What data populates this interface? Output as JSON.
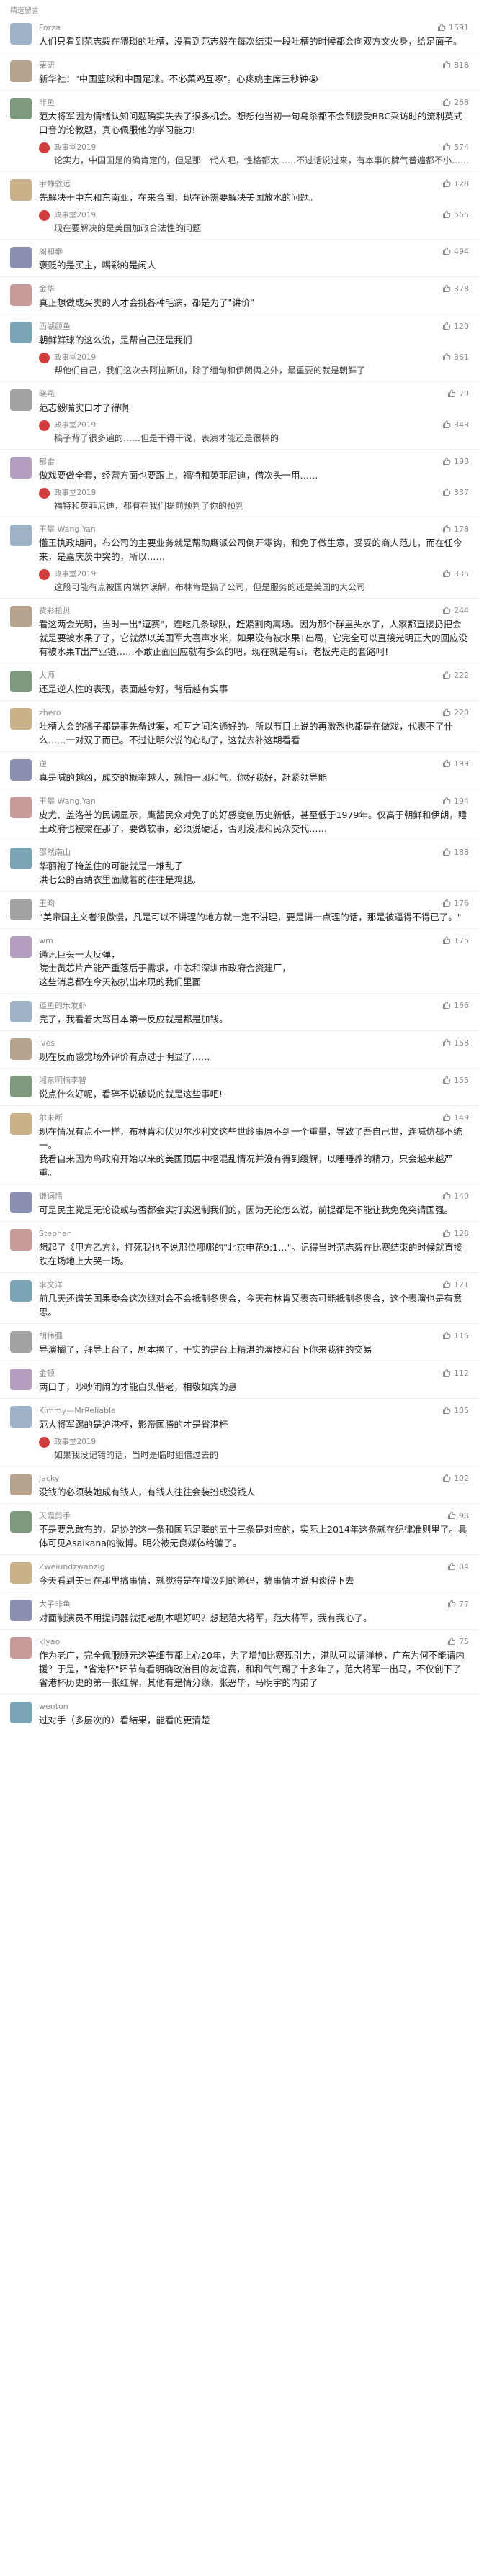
{
  "header": {
    "title": "精选留言"
  },
  "comments": [
    {
      "name": "Forza",
      "likes": "1591",
      "text": "人们只看到范志毅在猥琐的吐槽，没看到范志毅在每次结束一段吐槽的时候都会向双方文火身，给足面子。",
      "reply": null
    },
    {
      "name": "栗研",
      "likes": "818",
      "text": "新华社：\"中国篮球和中国足球，不必菜鸡互啄\"。心疼姚主席三秒钟😭",
      "reply": null
    },
    {
      "name": "非鱼",
      "likes": "268",
      "text": "范大将军因为情绪认知问题确实失去了很多机会。想想他当初一句乌杀都不会到接受BBC采访时的流利英式口音的论教题，真心佩服他的学习能力!",
      "reply": {
        "name": "政事堂2019",
        "likes": "574",
        "text": "论实力，中国国足的确肯定的，但是那一代人吧，性格都太……不过话说过来，有本事的脾气普遍都不小……"
      }
    },
    {
      "name": "宇静敦远",
      "likes": "128",
      "text": "先解决于中东和东南亚，在来合围，现在还需要解决美国放水的问题。",
      "reply": {
        "name": "政事堂2019",
        "likes": "565",
        "text": "现在要解决的是美国加政合法性的问题"
      }
    },
    {
      "name": "阁和泰",
      "likes": "494",
      "text": "褒贬的是买主，喝彩的是闲人",
      "reply": null
    },
    {
      "name": "金华",
      "likes": "378",
      "text": "真正想做成买卖的人才会挑各种毛病，都是为了\"讲价\"",
      "reply": null
    },
    {
      "name": "西湖颜鱼",
      "likes": "120",
      "text": "朝鲜鲜球的这么说，是帮自己还是我们",
      "reply": {
        "name": "政事堂2019",
        "likes": "361",
        "text": "帮他们自己，我们这次去阿拉斯加，除了缅甸和伊朗俩之外，最重要的就是朝鲜了"
      }
    },
    {
      "name": "晓燕",
      "likes": "79",
      "text": "范志毅嘴实口才了得啊",
      "reply": {
        "name": "政事堂2019",
        "likes": "343",
        "text": "稿子背了很多遍的……但是干得干说，表演才能还是很棒的"
      }
    },
    {
      "name": "郁雷",
      "likes": "198",
      "text": "做戏要做全套，经营方面也要跟上，福特和英菲尼迪，借次头一用……",
      "reply": {
        "name": "政事堂2019",
        "likes": "337",
        "text": "福特和英菲尼迪，都有在我们提前预判了你的预判"
      }
    },
    {
      "name": "王攀 Wang Yan",
      "likes": "178",
      "text": "懂王执政期间，布公司的主要业务就是帮助鹰派公司倒开零钩，和免子做生意，妥妥的商人范儿，而在任今来，是嘉庆茨中突的，所以……",
      "reply": {
        "name": "政事堂2019",
        "likes": "335",
        "text": "这段可能有点被国内媒体误解，布林肯是搞了公司，但是服务的还是美国的大公司"
      }
    },
    {
      "name": "费彩拾贝",
      "likes": "244",
      "text": "看这两会光明，当时一出\"逗赛\"，连吃几条球队，赶紧割肉离场。因为那个群里头水了，人家都直接扔把会就是要被水果了了，它就然以美国军大喜声水米，如果没有被水果T出局，它完全可以直接光明正大的回应没有被水果T出产业链……不敢正面回应就有多么的吧，现在就是有si，老板先走的套路呵!",
      "reply": null
    },
    {
      "name": "大师",
      "likes": "222",
      "text": "还是逆人性的表现，表面越夸好，背后越有实事",
      "reply": null
    },
    {
      "name": "zhero",
      "likes": "220",
      "text": "吐槽大会的稿子都是事先备过案，相互之间沟通好的。所以节目上说的再激烈也都是在做戏，代表不了什么……一对双子而已。不过让明公说的心动了，这就去补这期看看",
      "reply": null
    },
    {
      "name": "逆",
      "likes": "199",
      "text": "真是喊的越凶，成交的概率越大，就怕一团和气，你好我好，赶紧领导能",
      "reply": null
    },
    {
      "name": "王攀 Wang Yan",
      "likes": "194",
      "text": "皮尤、盖洛普的民调显示，鹰酱民众对免子的好感度创历史新低，甚至低于1979年。仅高于朝鲜和伊朗，睡王政府也被架在那了，要做软事，必须说硬话，否则没法和民众交代……",
      "reply": null
    },
    {
      "name": "邵然南山",
      "likes": "188",
      "text": "华丽袍子掩盖住的可能就是一堆乱子\n洪七公的百纳衣里面藏着的往往是鸡腿。",
      "reply": null
    },
    {
      "name": "王昀",
      "likes": "176",
      "text": "\"美帝国主义者很傲慢，凡是可以不讲理的地方就一定不讲理，要是讲一点理的话，那是被逼得不得已了。\"",
      "reply": null
    },
    {
      "name": "wm",
      "likes": "175",
      "text": "通讯巨头一大反弹，\n院士黄芯片产能严重落后于需求，中芯和深圳市政府合资建厂，\n这些消息都在今天被扒出来现的我们里面",
      "reply": null
    },
    {
      "name": "道鱼的乐发虾",
      "likes": "166",
      "text": "完了，我看着大骂日本第一反应就是都是加钱。",
      "reply": null
    },
    {
      "name": "lves",
      "likes": "158",
      "text": "现在反而感觉场外评价有点过于明显了……",
      "reply": null
    },
    {
      "name": "湘东明楠李智",
      "likes": "155",
      "text": "说点什么好呢，看碎不说破说的就是这些事吧!",
      "reply": null
    },
    {
      "name": "尔未断",
      "likes": "149",
      "text": "现在情况有点不一样，布林肯和伏贝尔沙利文这些世岭事原不到一个重量，导致了吾自己世，连喊仿都不统一。\n我看自来因为鸟政府开始以来的美国顶层中枢混乱情况并没有得到缓解，以睡睡养的精力，只会越来越严重。",
      "reply": null
    },
    {
      "name": "谦词情",
      "likes": "140",
      "text": "可是民主党是无论设或与否都会实打实遏制我们的，因为无论怎么说，前提都是不能让我免免突请国强。",
      "reply": null
    },
    {
      "name": "Stephen",
      "likes": "128",
      "text": "想起了《甲方乙方》，打死我也不说那位哪哪的\"北京申花9:1…\"。记得当时范志毅在比赛结束的时候就直接跌在场地上大哭一场。",
      "reply": null
    },
    {
      "name": "李文洋",
      "likes": "121",
      "text": "前几天还谱美国果委会这次继对会不会抵制冬奥会，今天布林肯又表态可能抵制冬奥会，这个表演也是有意思。",
      "reply": null
    },
    {
      "name": "胡伟强",
      "likes": "116",
      "text": "导演搁了，拜导上台了，剧本换了，干实的是台上精湛的演技和台下你来我往的交易",
      "reply": null
    },
    {
      "name": "金顿",
      "likes": "112",
      "text": "两口子，吵吵闹闹的才能白头偕老，相敬如宾的悬",
      "reply": null
    },
    {
      "name": "Kimmy—MrReliable",
      "likes": "105",
      "text": "范大将军踢的是沪港杯，影帝国腾的才是省港杯",
      "reply": {
        "name": "政事堂2019",
        "likes": "",
        "text": "如果我没记错的话，当时是临时组借过去的"
      }
    },
    {
      "name": "Jacky",
      "likes": "102",
      "text": "没钱的必须装她成有钱人，有钱人往往会装扮成没钱人",
      "reply": null
    },
    {
      "name": "天霞剪手",
      "likes": "98",
      "text": "不是要急敢布的，足协的这一条和国际足联的五十三条是对应的，实际上2014年这条就在纪律准则里了。具体可见Asaikana的微博。明公被无良媒体给骗了。",
      "reply": null
    },
    {
      "name": "Zweiundzwanzig",
      "likes": "84",
      "text": "今天看到美日在那里搞事情，就觉得是在增议判的筹码，搞事情才说明谈得下去",
      "reply": null
    },
    {
      "name": "大子非鱼",
      "likes": "77",
      "text": "对面制演员不用提词器就把老剧本唱好吗？想起范大将军，范大将军，我有我心了。",
      "reply": null
    },
    {
      "name": "klyao",
      "likes": "75",
      "text": "作为老广，完全佩服顾元这等细节都上心20年，为了增加比赛现引力，港队可以请洋枪，广东为何不能请内援？于是，\"省港杯\"环节有看明确政治目的友谊赛，和和气气踢了十多年了，范大将军一出马，不仅创下了省港杯历史的第一张红牌，其他有是情分缘，张恶毕，马明宇的内弟了",
      "reply": null
    },
    {
      "name": "wenton",
      "likes": "",
      "text": "过对手（多层次的）看结果，能看的更清楚",
      "reply": null
    }
  ]
}
